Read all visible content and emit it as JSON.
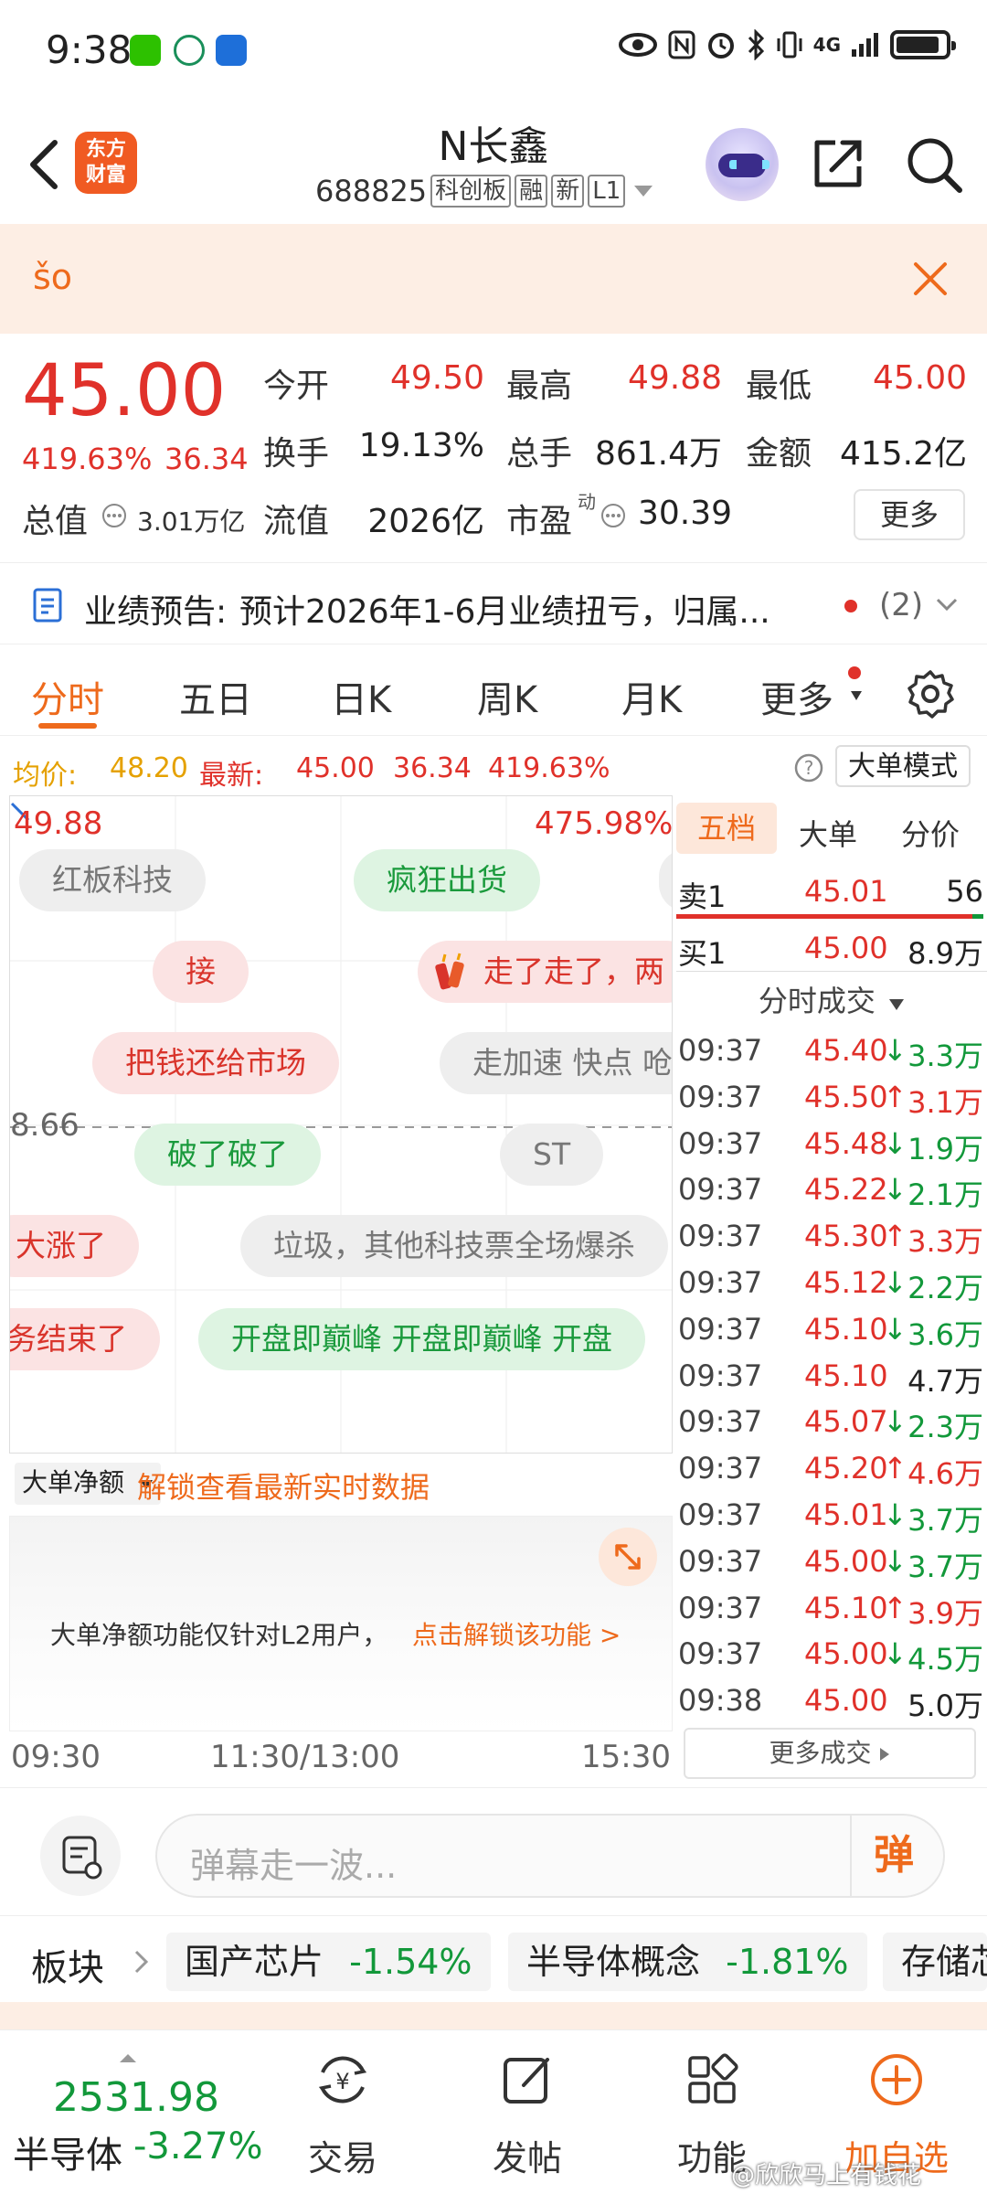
{
  "status_bar": {
    "time": "9:38",
    "network": "4G"
  },
  "header": {
    "logo_text_line1": "东方",
    "logo_text_line2": "财富",
    "stock_name": "N长鑫",
    "stock_code": "688825",
    "tags": [
      "科创板",
      "融",
      "新",
      "L1"
    ]
  },
  "banner": {
    "text": "šo"
  },
  "quote": {
    "price": "45.00",
    "change_pct": "419.63%",
    "change_abs": "36.34",
    "open_label": "今开",
    "open": "49.50",
    "high_label": "最高",
    "high": "49.88",
    "low_label": "最低",
    "low": "45.00",
    "turnover_label": "换手",
    "turnover": "19.13%",
    "volume_label": "总手",
    "volume": "861.4万",
    "amount_label": "金额",
    "amount": "415.2亿",
    "total_value_label": "总值",
    "total_value": "3.01万亿",
    "float_value_label": "流值",
    "float_value": "2026亿",
    "pe_label": "市盈",
    "pe_sup": "动",
    "pe": "30.39",
    "more_label": "更多"
  },
  "notice": {
    "label": "业绩预告:",
    "text": "预计2026年1-6月业绩扭亏，归属...",
    "count": "(2)"
  },
  "tabs": {
    "items": [
      "分时",
      "五日",
      "日K",
      "周K",
      "月K",
      "更多"
    ],
    "active": "分时"
  },
  "avg_line": {
    "avg_label": "均价:",
    "avg": "48.20",
    "latest_label": "最新:",
    "latest": "45.00",
    "change_abs": "36.34",
    "change_pct": "419.63%",
    "mode_button": "大单模式"
  },
  "chart": {
    "top_price": "49.88",
    "top_pct": "475.98%",
    "prev_close": "8.66",
    "time_labels": [
      "09:30",
      "11:30/13:00",
      "15:30"
    ],
    "danmaku": [
      {
        "text": "红板科技",
        "style": "gray"
      },
      {
        "text": "疯狂出货",
        "style": "green"
      },
      {
        "text": "接",
        "style": "red"
      },
      {
        "text": "走了走了，两",
        "style": "red"
      },
      {
        "text": "把钱还给市场",
        "style": "red"
      },
      {
        "text": "走加速 快点 呛",
        "style": "gray"
      },
      {
        "text": "破了破了",
        "style": "green"
      },
      {
        "text": "ST",
        "style": "gray"
      },
      {
        "text": "大涨了",
        "style": "red"
      },
      {
        "text": "垃圾，其他科技票全场爆杀",
        "style": "gray"
      },
      {
        "text": "务结束了",
        "style": "red"
      },
      {
        "text": "开盘即巅峰  开盘即巅峰  开盘",
        "style": "green"
      }
    ],
    "big_order_selector": "大单净额",
    "unlock_text": "解锁查看最新实时数据",
    "l2_notice": "大单净额功能仅针对L2用户，",
    "l2_link": "点击解锁该功能 >"
  },
  "order_book": {
    "tabs": [
      "五档",
      "大单",
      "分价"
    ],
    "active_tab": "五档",
    "sell1": {
      "label": "卖1",
      "price": "45.01",
      "vol": "56"
    },
    "buy1": {
      "label": "买1",
      "price": "45.00",
      "vol": "8.9万"
    },
    "trades_header": "分时成交",
    "trades": [
      {
        "time": "09:37",
        "price": "45.40",
        "dir": "down",
        "vol": "3.3万"
      },
      {
        "time": "09:37",
        "price": "45.50",
        "dir": "up",
        "vol": "3.1万"
      },
      {
        "time": "09:37",
        "price": "45.48",
        "dir": "down",
        "vol": "1.9万"
      },
      {
        "time": "09:37",
        "price": "45.22",
        "dir": "down",
        "vol": "2.1万"
      },
      {
        "time": "09:37",
        "price": "45.30",
        "dir": "up",
        "vol": "3.3万"
      },
      {
        "time": "09:37",
        "price": "45.12",
        "dir": "down",
        "vol": "2.2万"
      },
      {
        "time": "09:37",
        "price": "45.10",
        "dir": "down",
        "vol": "3.6万"
      },
      {
        "time": "09:37",
        "price": "45.10",
        "dir": "none",
        "vol": "4.7万"
      },
      {
        "time": "09:37",
        "price": "45.07",
        "dir": "down",
        "vol": "2.3万"
      },
      {
        "time": "09:37",
        "price": "45.20",
        "dir": "up",
        "vol": "4.6万"
      },
      {
        "time": "09:37",
        "price": "45.01",
        "dir": "down",
        "vol": "3.7万"
      },
      {
        "time": "09:37",
        "price": "45.00",
        "dir": "down",
        "vol": "3.7万"
      },
      {
        "time": "09:37",
        "price": "45.10",
        "dir": "up",
        "vol": "3.9万"
      },
      {
        "time": "09:37",
        "price": "45.00",
        "dir": "down",
        "vol": "4.5万"
      },
      {
        "time": "09:38",
        "price": "45.00",
        "dir": "none",
        "vol": "5.0万"
      }
    ],
    "more_trades": "更多成交"
  },
  "danmaku_bar": {
    "placeholder": "弹幕走一波...",
    "send_label": "弹"
  },
  "sector_bar": {
    "label": "板块",
    "items": [
      {
        "name": "国产芯片",
        "pct": "-1.54%"
      },
      {
        "name": "半导体概念",
        "pct": "-1.81%"
      },
      {
        "name": "存储芯",
        "pct": ""
      }
    ]
  },
  "bottom_nav": {
    "index_value": "2531.98",
    "index_name": "半导体",
    "index_pct": "-3.27%",
    "items": [
      "交易",
      "发帖",
      "功能",
      "加自选"
    ],
    "watermark": "@欣欣马上有钱花"
  },
  "colors": {
    "up": "#e0312a",
    "down": "#12983a",
    "accent": "#ee6a1c"
  }
}
